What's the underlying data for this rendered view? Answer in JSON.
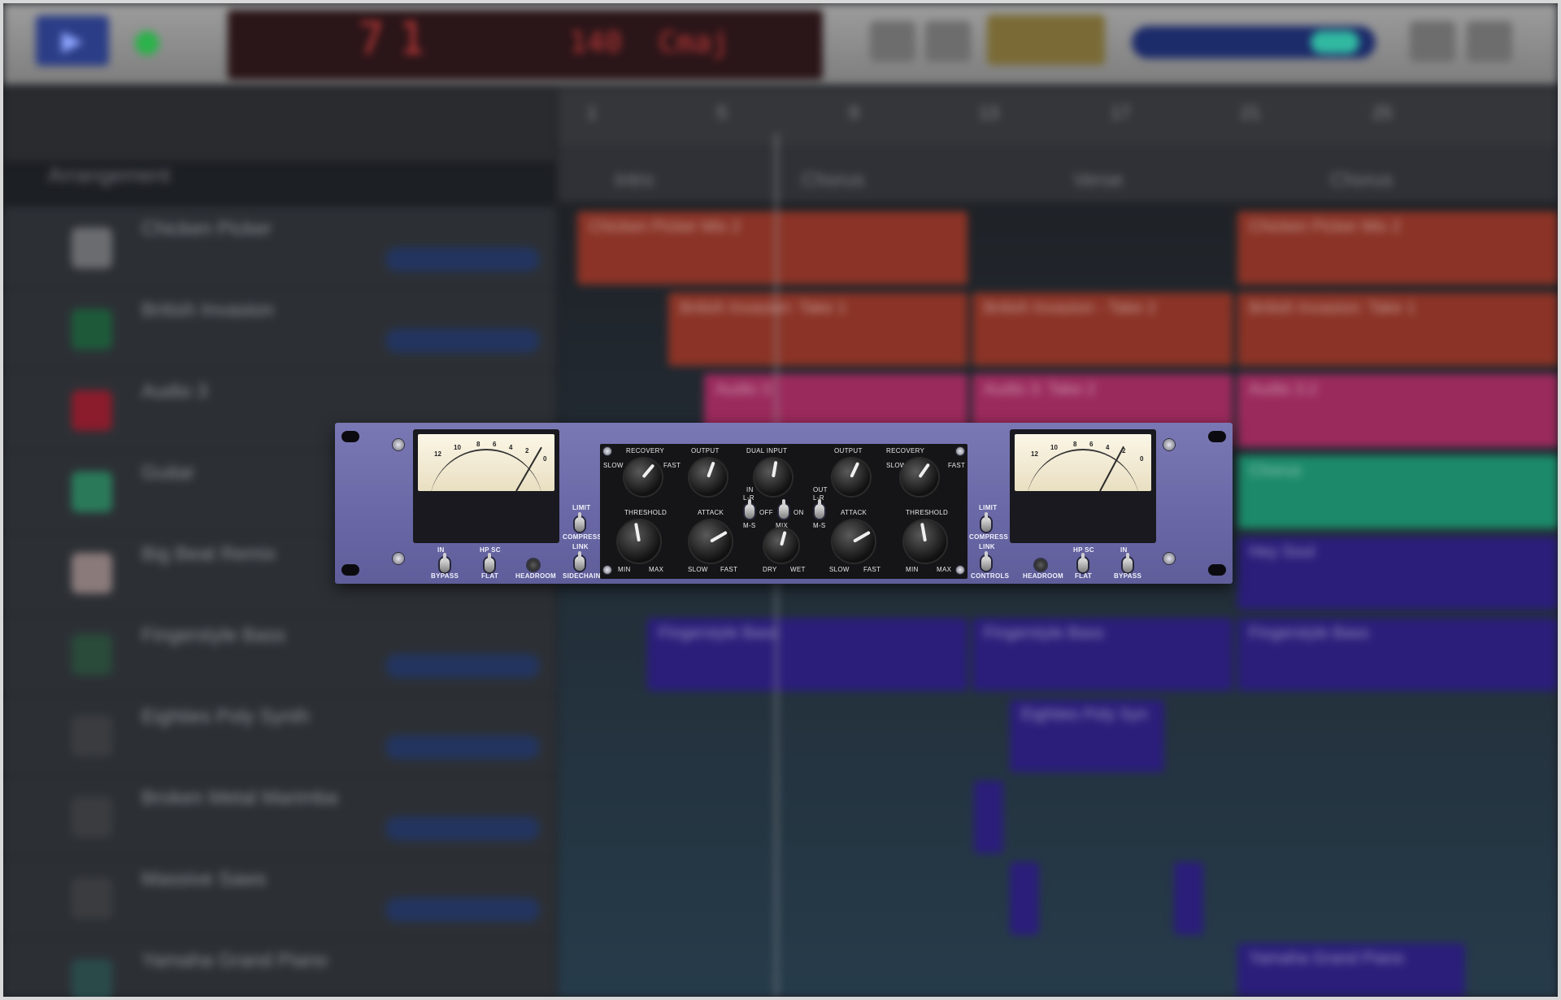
{
  "daw": {
    "lcd": {
      "bar": "7",
      "beat": "1",
      "tempo": "140",
      "key": "Cmaj"
    },
    "arrangement_label": "Arrangement",
    "tracks": [
      {
        "name": "Chicken Picker"
      },
      {
        "name": "British Invasion"
      },
      {
        "name": "Audio 3"
      },
      {
        "name": "Guitar"
      },
      {
        "name": "Big Beat Remix"
      },
      {
        "name": "Fingerstyle Bass"
      },
      {
        "name": "Eighties Poly Synth"
      },
      {
        "name": "Broken Metal Marimba"
      },
      {
        "name": "Massive Saws"
      },
      {
        "name": "Yamaha Grand Piano"
      }
    ],
    "ruler": [
      "1",
      "5",
      "9",
      "13",
      "17",
      "21",
      "25"
    ],
    "markers": [
      "Intro",
      "Chorus",
      "Verse",
      "Chorus"
    ],
    "regions": {
      "r1": "Chicken Picker Mix 2",
      "r2": "Chicken Picker Mix 2",
      "r3": "British Invasion: Take 1",
      "r4": "British Invasion - Take 2",
      "r5": "British Invasion: Take 1",
      "r6": "Audio 3",
      "r7": "Audio 3: Take 2",
      "r8": "Audio 3.2",
      "r9": "Chorus",
      "r10": "Hey Soul",
      "r11": "Fingerstyle Bass",
      "r12": "Fingerstyle Bass",
      "r13": "Fingerstyle Bass",
      "r14": "Eighties Poly Syn",
      "r15": "Yamaha Grand Piano"
    },
    "colors": {
      "accent": "#2b3d86",
      "record": "#2cb24a",
      "lcd_text": "#c23a3a",
      "plugin_face": "#6f6dab"
    }
  },
  "plugin": {
    "meter_scale": [
      "12",
      "10",
      "8",
      "6",
      "4",
      "2",
      "0"
    ],
    "labels": {
      "recovery": "RECOVERY",
      "slow": "SLOW",
      "fast": "FAST",
      "output": "OUTPUT",
      "dual_input": "DUAL INPUT",
      "threshold": "THRESHOLD",
      "attack": "ATTACK",
      "min": "MIN",
      "max": "MAX",
      "mix": "MIX",
      "dry": "DRY",
      "wet": "WET",
      "in": "IN",
      "out": "OUT",
      "lr": "L-R",
      "ms": "M-S",
      "off": "OFF",
      "on": "ON",
      "limit": "LIMIT",
      "compress": "COMPRESS",
      "link": "LINK",
      "sidechain": "SIDECHAIN",
      "controls": "CONTROLS",
      "bypass": "BYPASS",
      "hp_sc": "HP SC",
      "flat": "FLAT",
      "headroom": "HEADROOM"
    }
  }
}
